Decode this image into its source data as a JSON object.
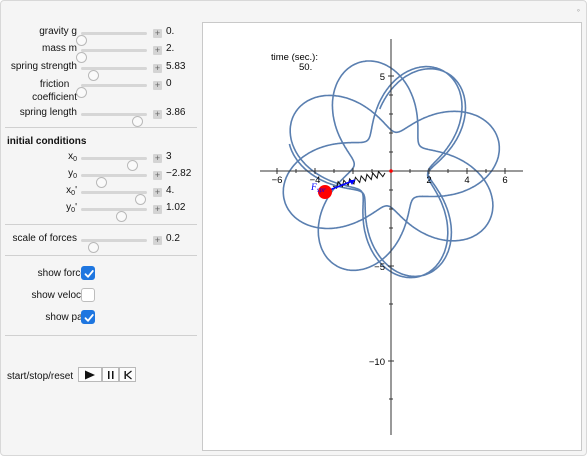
{
  "sliders": [
    {
      "label": "gravity g",
      "value": "0.",
      "fraction": 0.0
    },
    {
      "label": "mass m",
      "value": "2.",
      "fraction": 0.0
    },
    {
      "label": "spring strength",
      "value": "5.83",
      "fraction": 0.18
    },
    {
      "label": "friction",
      "label2": "coefficient",
      "value": "0",
      "fraction": 0.0
    },
    {
      "label": "spring length",
      "value": "3.86",
      "fraction": 0.85
    }
  ],
  "initial_conditions": {
    "title": "initial conditions",
    "sliders": [
      {
        "label": "x",
        "sub": "0",
        "value": "3",
        "fraction": 0.77
      },
      {
        "label": "y",
        "sub": "0",
        "value": "−2.82",
        "fraction": 0.3
      },
      {
        "label": "x",
        "sub": "0",
        "suffix": "'",
        "value": "4.",
        "fraction": 0.9
      },
      {
        "label": "y",
        "sub": "0",
        "suffix": "'",
        "value": "1.02",
        "fraction": 0.6
      }
    ]
  },
  "scale_of_forces": {
    "label": "scale of forces",
    "value": "0.2",
    "fraction": 0.18
  },
  "checkboxes": [
    {
      "label": "show forces",
      "checked": true
    },
    {
      "label": "show velocity",
      "checked": false
    },
    {
      "label": "show path",
      "checked": true
    }
  ],
  "controls": {
    "label": "start/stop/reset"
  },
  "plot": {
    "time_label": "time (sec.):",
    "time_value": "50.",
    "x_ticks": [
      "−6",
      "−4",
      "2",
      "4",
      "6"
    ],
    "y_ticks": [
      "5",
      "−5",
      "−10"
    ],
    "force_label": "F",
    "force_sub": "spr",
    "path_color": "#5a7fb0",
    "mass_color": "#ff0000",
    "force_color": "#0000ff"
  }
}
